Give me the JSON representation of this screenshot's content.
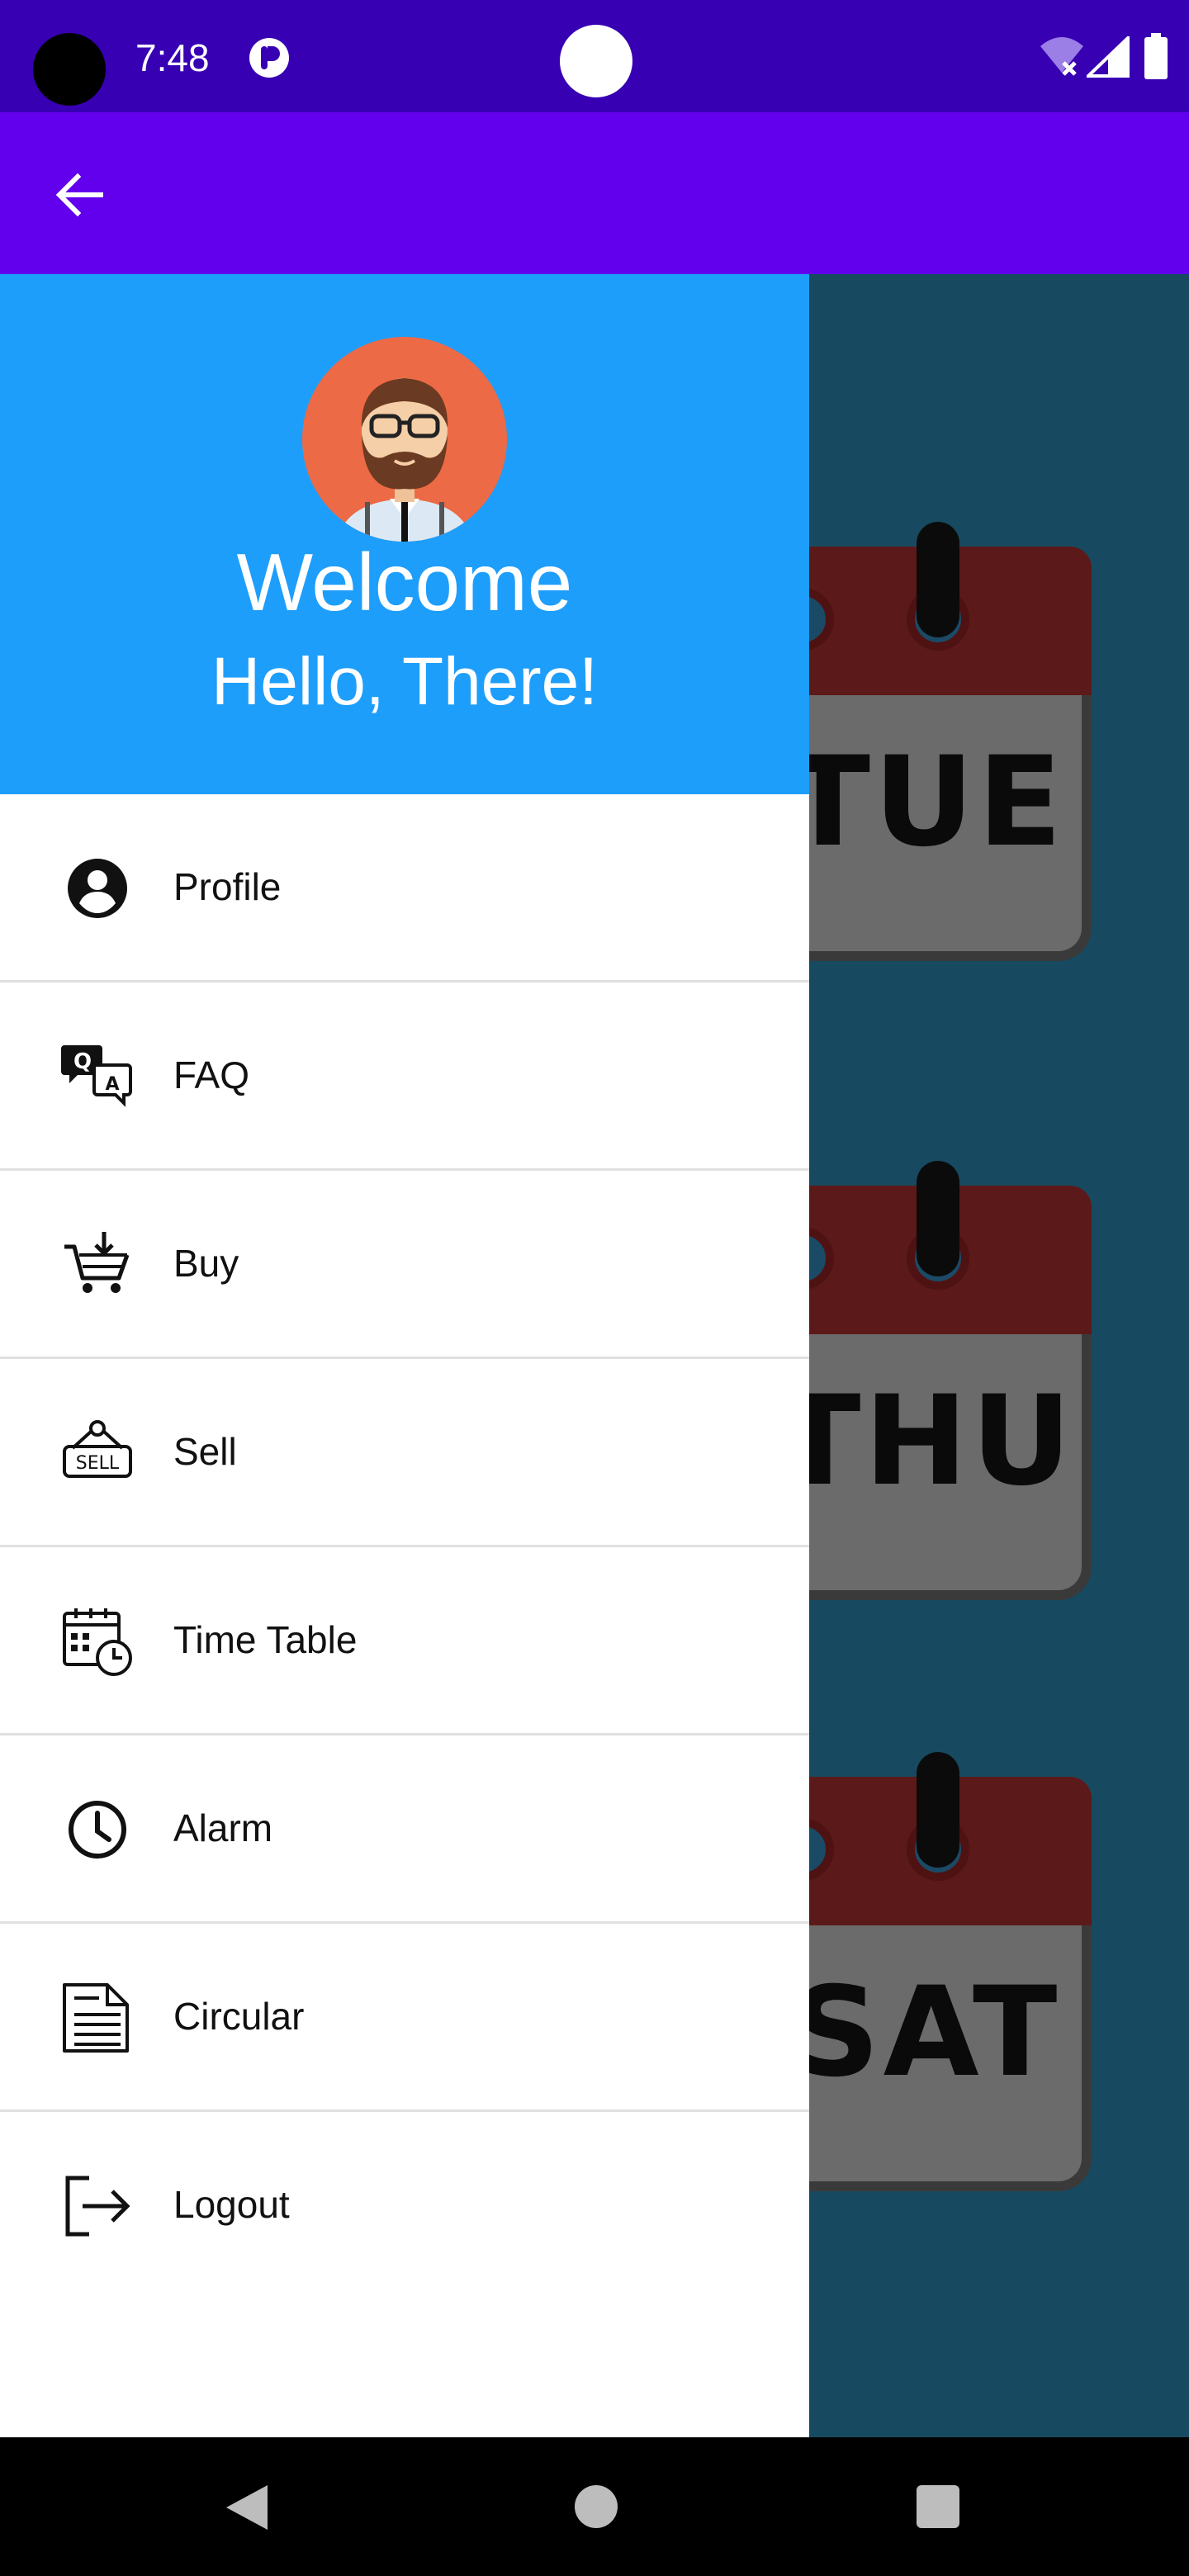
{
  "status_bar": {
    "time": "7:48",
    "icons": [
      "camera-cutout",
      "app-notification-icon",
      "wifi-off-icon",
      "signal-icon",
      "battery-icon"
    ]
  },
  "app_bar": {
    "back_icon": "arrow-back-icon"
  },
  "drawer": {
    "header": {
      "avatar_icon": "bearded-man-avatar",
      "title": "Welcome",
      "subtitle": "Hello, There!"
    },
    "items": [
      {
        "label": "Profile",
        "icon": "account-circle-icon"
      },
      {
        "label": "FAQ",
        "icon": "qa-chat-icon"
      },
      {
        "label": "Buy",
        "icon": "cart-download-icon"
      },
      {
        "label": "Sell",
        "icon": "sell-sign-icon"
      },
      {
        "label": "Time Table",
        "icon": "calendar-clock-icon"
      },
      {
        "label": "Alarm",
        "icon": "clock-icon"
      },
      {
        "label": "Circular",
        "icon": "document-icon"
      },
      {
        "label": "Logout",
        "icon": "logout-icon"
      }
    ]
  },
  "background": {
    "calendar_labels": [
      "TUE",
      "THU",
      "SAT"
    ]
  },
  "colors": {
    "status_bar": "#3700b3",
    "app_bar": "#6200ee",
    "drawer_header": "#1e9efb",
    "background": "#174a60",
    "calendar_top": "#5c1919"
  },
  "nav_bar": {
    "buttons": [
      "back",
      "home",
      "recents"
    ]
  }
}
